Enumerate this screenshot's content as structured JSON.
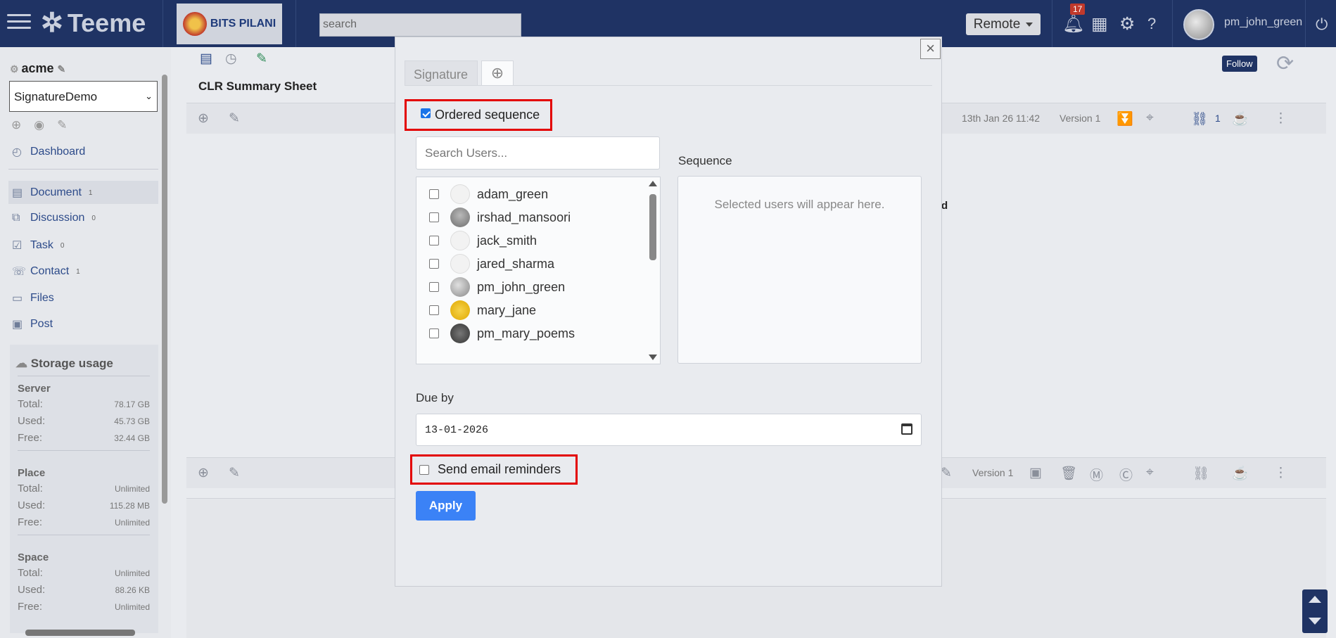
{
  "header": {
    "brand": "Teeme",
    "org_badge": "BITS PILANI",
    "search_placeholder": "search",
    "location_select": "Remote",
    "notification_count": "17",
    "username": "pm_john_green"
  },
  "sidebar": {
    "org_name": "acme",
    "space_select": "SignatureDemo",
    "nav": [
      {
        "label": "Dashboard",
        "icon": "dashboard-icon"
      },
      {
        "label": "Document",
        "count": "1",
        "icon": "document-icon"
      },
      {
        "label": "Discussion",
        "count": "0",
        "icon": "discussion-icon"
      },
      {
        "label": "Task",
        "count": "0",
        "icon": "task-icon"
      },
      {
        "label": "Contact",
        "count": "1",
        "icon": "contact-icon"
      },
      {
        "label": "Files",
        "icon": "folder-icon"
      },
      {
        "label": "Post",
        "icon": "post-icon"
      }
    ],
    "storage": {
      "title": "Storage usage",
      "sections": [
        {
          "name": "Server",
          "rows": [
            {
              "label": "Total:",
              "value": "78.17 GB"
            },
            {
              "label": "Used:",
              "value": "45.73 GB"
            },
            {
              "label": "Free:",
              "value": "32.44 GB"
            }
          ]
        },
        {
          "name": "Place",
          "rows": [
            {
              "label": "Total:",
              "value": "Unlimited"
            },
            {
              "label": "Used:",
              "value": "115.28 MB"
            },
            {
              "label": "Free:",
              "value": "Unlimited"
            }
          ]
        },
        {
          "name": "Space",
          "rows": [
            {
              "label": "Total:",
              "value": "Unlimited"
            },
            {
              "label": "Used:",
              "value": "88.26 KB"
            },
            {
              "label": "Free:",
              "value": "Unlimited"
            }
          ]
        }
      ]
    }
  },
  "main": {
    "doc_title": "CLR Summary Sheet",
    "follow_label": "Follow",
    "top_row": {
      "date": "13th Jan 26 11:42",
      "version": "Version 1",
      "link_count": "1"
    },
    "bottom_row": {
      "version": "Version 1"
    },
    "stray_text": "d"
  },
  "modal": {
    "tab_label": "Signature",
    "ordered_label": "Ordered sequence",
    "ordered_checked": true,
    "search_placeholder": "Search Users...",
    "users": [
      {
        "name": "adam_green",
        "avatar": "default"
      },
      {
        "name": "irshad_mansoori",
        "avatar": "hat"
      },
      {
        "name": "jack_smith",
        "avatar": "default"
      },
      {
        "name": "jared_sharma",
        "avatar": "default"
      },
      {
        "name": "pm_john_green",
        "avatar": "gray"
      },
      {
        "name": "mary_jane",
        "avatar": "yellow"
      },
      {
        "name": "pm_mary_poems",
        "avatar": "dark"
      }
    ],
    "sequence_label": "Sequence",
    "sequence_placeholder": "Selected users will appear here.",
    "due_label": "Due by",
    "due_value": "13-01-2026",
    "reminders_label": "Send email reminders",
    "reminders_checked": false,
    "apply_label": "Apply"
  },
  "colors": {
    "topbar": "#1f3364",
    "accent": "#3b82f6",
    "highlight": "#e30000"
  }
}
